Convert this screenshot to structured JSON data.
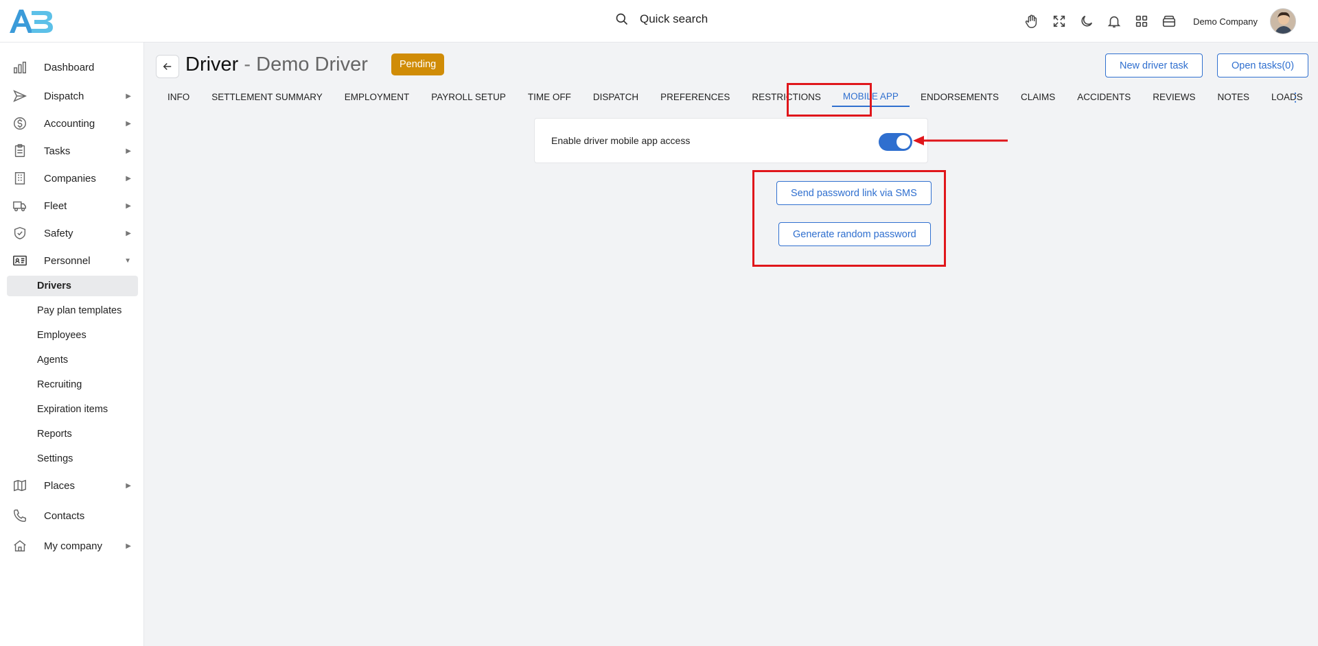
{
  "topbar": {
    "search_label": "Quick search",
    "company_name": "Demo Company",
    "icons": [
      "hand-icon",
      "fullscreen-icon",
      "moon-icon",
      "bell-icon",
      "apps-grid-icon",
      "wallet-icon"
    ]
  },
  "sidebar": {
    "items": [
      {
        "label": "Dashboard",
        "icon": "chart-icon"
      },
      {
        "label": "Dispatch",
        "icon": "send-icon"
      },
      {
        "label": "Accounting",
        "icon": "dollar-icon"
      },
      {
        "label": "Tasks",
        "icon": "clipboard-icon"
      },
      {
        "label": "Companies",
        "icon": "building-icon"
      },
      {
        "label": "Fleet",
        "icon": "truck-icon"
      },
      {
        "label": "Safety",
        "icon": "shield-icon"
      },
      {
        "label": "Personnel",
        "icon": "id-card-icon"
      },
      {
        "label": "Places",
        "icon": "map-icon"
      },
      {
        "label": "Contacts",
        "icon": "phone-icon"
      },
      {
        "label": "My company",
        "icon": "home-icon"
      }
    ],
    "personnel_sub": [
      "Drivers",
      "Pay plan templates",
      "Employees",
      "Agents",
      "Recruiting",
      "Expiration items",
      "Reports",
      "Settings"
    ],
    "active_sub": "Drivers"
  },
  "header": {
    "title": "Driver",
    "separator": "-",
    "subtitle": "Demo Driver",
    "status": "Pending",
    "new_task_label": "New driver task",
    "open_tasks_label": "Open tasks(0)"
  },
  "tabs": [
    "INFO",
    "SETTLEMENT SUMMARY",
    "EMPLOYMENT",
    "PAYROLL SETUP",
    "TIME OFF",
    "DISPATCH",
    "PREFERENCES",
    "RESTRICTIONS",
    "MOBILE APP",
    "ENDORSEMENTS",
    "CLAIMS",
    "ACCIDENTS",
    "REVIEWS",
    "NOTES",
    "LOADS"
  ],
  "active_tab": "MOBILE APP",
  "mobile_app": {
    "enable_label": "Enable driver mobile app access",
    "enabled": true,
    "send_sms_label": "Send password link via SMS",
    "generate_password_label": "Generate random password"
  },
  "colors": {
    "accent": "#2f6fcf",
    "status_pending": "#d08c07",
    "annotation": "#e0161b"
  }
}
